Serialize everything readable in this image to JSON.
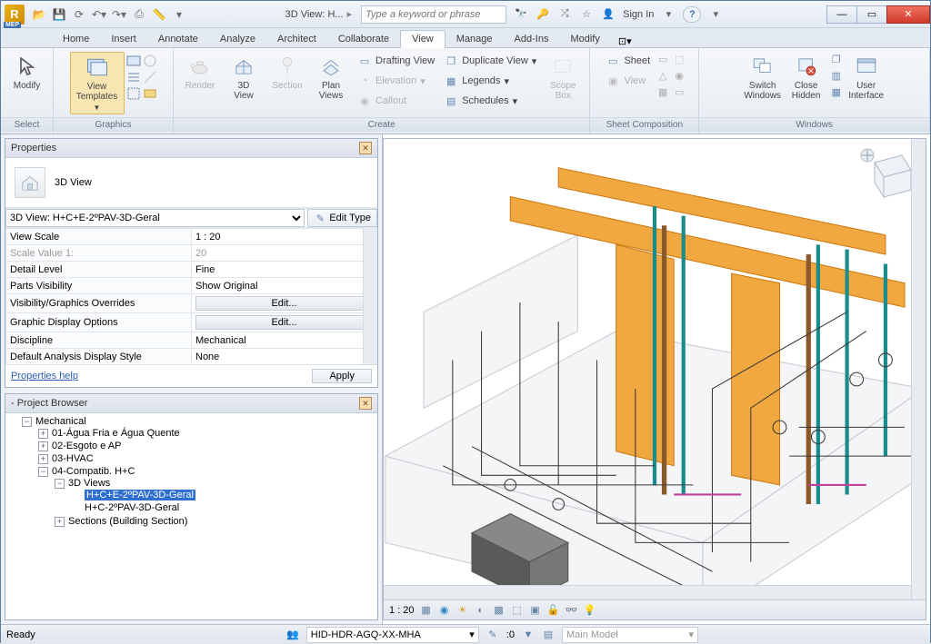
{
  "app": {
    "badge": "MEP",
    "title_short": "3D View: H..."
  },
  "search": {
    "placeholder": "Type a keyword or phrase"
  },
  "signin": "Sign In",
  "tabs": {
    "home": "Home",
    "insert": "Insert",
    "annotate": "Annotate",
    "analyze": "Analyze",
    "architect": "Architect",
    "collaborate": "Collaborate",
    "view": "View",
    "manage": "Manage",
    "addins": "Add-Ins",
    "modify": "Modify"
  },
  "ribbon": {
    "select": {
      "label": "Select",
      "modify": "Modify"
    },
    "graphics": {
      "label": "Graphics",
      "view_templates": "View\nTemplates",
      "render": "Render",
      "three_d": "3D\nView",
      "section": "Section",
      "plan_views": "Plan\nViews"
    },
    "create": {
      "label": "Create",
      "drafting": "Drafting View",
      "elevation": "Elevation",
      "callout": "Callout",
      "duplicate": "Duplicate View",
      "legends": "Legends",
      "schedules": "Schedules",
      "scope": "Scope\nBox"
    },
    "sheet": {
      "label": "Sheet Composition",
      "sheet": "Sheet",
      "view": "View"
    },
    "windows": {
      "label": "Windows",
      "switch": "Switch\nWindows",
      "close_hidden": "Close\nHidden",
      "user_interface": "User\nInterface"
    }
  },
  "properties": {
    "title": "Properties",
    "type_label": "3D View",
    "selector": "3D View: H+C+E-2ºPAV-3D-Geral",
    "edit_type": "Edit Type",
    "rows": {
      "view_scale": {
        "k": "View Scale",
        "v": "1 : 20"
      },
      "scale_value": {
        "k": "Scale Value    1:",
        "v": "20"
      },
      "detail": {
        "k": "Detail Level",
        "v": "Fine"
      },
      "parts": {
        "k": "Parts Visibility",
        "v": "Show Original"
      },
      "vg": {
        "k": "Visibility/Graphics Overrides",
        "v": "Edit..."
      },
      "gdo": {
        "k": "Graphic Display Options",
        "v": "Edit..."
      },
      "discipline": {
        "k": "Discipline",
        "v": "Mechanical"
      },
      "analysis": {
        "k": "Default Analysis Display Style",
        "v": "None"
      }
    },
    "help": "Properties help",
    "apply": "Apply"
  },
  "browser": {
    "title": "- Project Browser",
    "mechanical": "Mechanical",
    "n1": "01-Água Fria e Água Quente",
    "n2": "02-Esgoto e AP",
    "n3": "03-HVAC",
    "n4": "04-Compatib. H+C",
    "n4_3d": "3D Views",
    "n4_3d_1": "H+C+E-2ºPAV-3D-Geral",
    "n4_3d_2": "H+C-2ºPAV-3D-Geral",
    "n4_sec": "Sections (Building Section)"
  },
  "viewport": {
    "scale": "1 : 20"
  },
  "status": {
    "ready": "Ready",
    "worksets": "HID-HDR-AGQ-XX-MHA",
    "sel": ":0",
    "model": "Main Model"
  }
}
